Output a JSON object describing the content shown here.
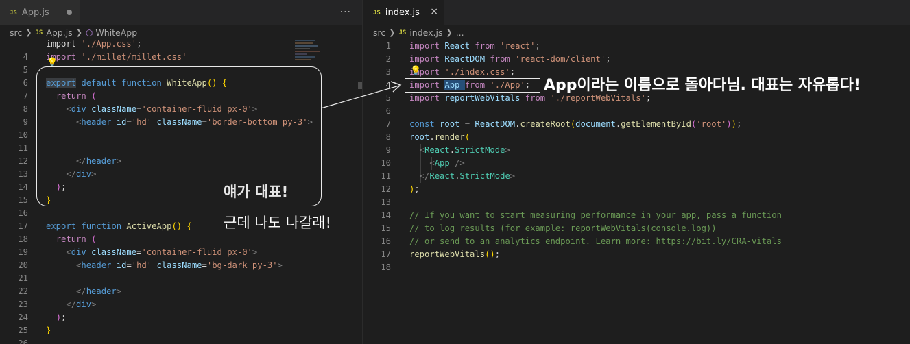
{
  "left_editor": {
    "tab": {
      "label": "App.js",
      "badge": "JS"
    },
    "breadcrumb": {
      "folder": "src",
      "file": "App.js",
      "badge": "JS",
      "symbol": "WhiteApp"
    },
    "more": "···",
    "lines": [
      {
        "n": "",
        "parts": [
          [
            "plain",
            "import "
          ],
          [
            "str",
            "'./App.css'"
          ],
          [
            "plain",
            ";"
          ]
        ]
      },
      {
        "n": "4",
        "parts": [
          [
            "kc",
            "import "
          ],
          [
            "str",
            "'./millet/millet.css'"
          ]
        ]
      },
      {
        "n": "5",
        "parts": []
      },
      {
        "n": "6",
        "parts": [
          [
            "kw",
            "export"
          ],
          [
            "plain",
            " "
          ],
          [
            "kw",
            "default "
          ],
          [
            "kw",
            "function "
          ],
          [
            "fn",
            "WhiteApp"
          ],
          [
            "br1",
            "()"
          ],
          [
            "plain",
            " "
          ],
          [
            "br1",
            "{"
          ]
        ]
      },
      {
        "n": "7",
        "parts": [
          [
            "plain",
            "  "
          ],
          [
            "kc",
            "return "
          ],
          [
            "br2",
            "("
          ]
        ]
      },
      {
        "n": "8",
        "parts": [
          [
            "plain",
            "    "
          ],
          [
            "pun",
            "<"
          ],
          [
            "tag",
            "div "
          ],
          [
            "attr",
            "className"
          ],
          [
            "plain",
            "="
          ],
          [
            "str",
            "'container-fluid px-0'"
          ],
          [
            "pun",
            ">"
          ]
        ]
      },
      {
        "n": "9",
        "parts": [
          [
            "plain",
            "      "
          ],
          [
            "pun",
            "<"
          ],
          [
            "tag",
            "header "
          ],
          [
            "attr",
            "id"
          ],
          [
            "plain",
            "="
          ],
          [
            "str",
            "'hd' "
          ],
          [
            "attr",
            "className"
          ],
          [
            "plain",
            "="
          ],
          [
            "str",
            "'border-bottom py-3'"
          ],
          [
            "pun",
            ">"
          ]
        ]
      },
      {
        "n": "10",
        "parts": []
      },
      {
        "n": "11",
        "parts": []
      },
      {
        "n": "12",
        "parts": [
          [
            "plain",
            "      "
          ],
          [
            "pun",
            "</"
          ],
          [
            "tag",
            "header"
          ],
          [
            "pun",
            ">"
          ]
        ]
      },
      {
        "n": "13",
        "parts": [
          [
            "plain",
            "    "
          ],
          [
            "pun",
            "</"
          ],
          [
            "tag",
            "div"
          ],
          [
            "pun",
            ">"
          ]
        ]
      },
      {
        "n": "14",
        "parts": [
          [
            "plain",
            "  "
          ],
          [
            "br2",
            ")"
          ],
          [
            "plain",
            ";"
          ]
        ]
      },
      {
        "n": "15",
        "parts": [
          [
            "br1",
            "}"
          ]
        ]
      },
      {
        "n": "16",
        "parts": []
      },
      {
        "n": "17",
        "parts": [
          [
            "kw",
            "export"
          ],
          [
            "plain",
            " "
          ],
          [
            "kw",
            "function "
          ],
          [
            "fn",
            "ActiveApp"
          ],
          [
            "br1",
            "()"
          ],
          [
            "plain",
            " "
          ],
          [
            "br1",
            "{"
          ]
        ]
      },
      {
        "n": "18",
        "parts": [
          [
            "plain",
            "  "
          ],
          [
            "kc",
            "return "
          ],
          [
            "br2",
            "("
          ]
        ]
      },
      {
        "n": "19",
        "parts": [
          [
            "plain",
            "    "
          ],
          [
            "pun",
            "<"
          ],
          [
            "tag",
            "div "
          ],
          [
            "attr",
            "className"
          ],
          [
            "plain",
            "="
          ],
          [
            "str",
            "'container-fluid px-0'"
          ],
          [
            "pun",
            ">"
          ]
        ]
      },
      {
        "n": "20",
        "parts": [
          [
            "plain",
            "      "
          ],
          [
            "pun",
            "<"
          ],
          [
            "tag",
            "header "
          ],
          [
            "attr",
            "id"
          ],
          [
            "plain",
            "="
          ],
          [
            "str",
            "'hd' "
          ],
          [
            "attr",
            "className"
          ],
          [
            "plain",
            "="
          ],
          [
            "str",
            "'bg-dark py-3'"
          ],
          [
            "pun",
            ">"
          ]
        ]
      },
      {
        "n": "21",
        "parts": []
      },
      {
        "n": "22",
        "parts": [
          [
            "plain",
            "      "
          ],
          [
            "pun",
            "</"
          ],
          [
            "tag",
            "header"
          ],
          [
            "pun",
            ">"
          ]
        ]
      },
      {
        "n": "23",
        "parts": [
          [
            "plain",
            "    "
          ],
          [
            "pun",
            "</"
          ],
          [
            "tag",
            "div"
          ],
          [
            "pun",
            ">"
          ]
        ]
      },
      {
        "n": "24",
        "parts": [
          [
            "plain",
            "  "
          ],
          [
            "br2",
            ")"
          ],
          [
            "plain",
            ";"
          ]
        ]
      },
      {
        "n": "25",
        "parts": [
          [
            "br1",
            "}"
          ]
        ]
      },
      {
        "n": "26",
        "parts": []
      }
    ]
  },
  "right_editor": {
    "tab": {
      "label": "index.js",
      "badge": "JS",
      "close": "×"
    },
    "breadcrumb": {
      "folder": "src",
      "file": "index.js",
      "badge": "JS",
      "symbol": "..."
    },
    "lines": [
      {
        "n": "1",
        "parts": [
          [
            "kc",
            "import "
          ],
          [
            "var",
            "React "
          ],
          [
            "kc",
            "from "
          ],
          [
            "str",
            "'react'"
          ],
          [
            "plain",
            ";"
          ]
        ]
      },
      {
        "n": "2",
        "parts": [
          [
            "kc",
            "import "
          ],
          [
            "var",
            "ReactDOM "
          ],
          [
            "kc",
            "from "
          ],
          [
            "str",
            "'react-dom/client'"
          ],
          [
            "plain",
            ";"
          ]
        ]
      },
      {
        "n": "3",
        "parts": [
          [
            "kc",
            "import "
          ],
          [
            "str",
            "'./index.css'"
          ],
          [
            "plain",
            ";"
          ]
        ]
      },
      {
        "n": "4",
        "parts": [
          [
            "kc",
            "import "
          ],
          [
            "var",
            "App "
          ],
          [
            "kc",
            "from "
          ],
          [
            "str",
            "'./App'"
          ],
          [
            "plain",
            ";"
          ]
        ]
      },
      {
        "n": "5",
        "parts": [
          [
            "kc",
            "import "
          ],
          [
            "var",
            "reportWebVitals "
          ],
          [
            "kc",
            "from "
          ],
          [
            "str",
            "'./reportWebVitals'"
          ],
          [
            "plain",
            ";"
          ]
        ]
      },
      {
        "n": "6",
        "parts": []
      },
      {
        "n": "7",
        "parts": [
          [
            "kw",
            "const "
          ],
          [
            "var",
            "root "
          ],
          [
            "plain",
            "= "
          ],
          [
            "var",
            "ReactDOM"
          ],
          [
            "plain",
            "."
          ],
          [
            "fn",
            "createRoot"
          ],
          [
            "br1",
            "("
          ],
          [
            "var",
            "document"
          ],
          [
            "plain",
            "."
          ],
          [
            "fn",
            "getElementById"
          ],
          [
            "br2",
            "("
          ],
          [
            "str",
            "'root'"
          ],
          [
            "br2",
            ")"
          ],
          [
            "br1",
            ")"
          ],
          [
            "plain",
            ";"
          ]
        ]
      },
      {
        "n": "8",
        "parts": [
          [
            "var",
            "root"
          ],
          [
            "plain",
            "."
          ],
          [
            "fn",
            "render"
          ],
          [
            "br1",
            "("
          ]
        ]
      },
      {
        "n": "9",
        "parts": [
          [
            "plain",
            "  "
          ],
          [
            "pun",
            "<"
          ],
          [
            "cls",
            "React"
          ],
          [
            "plain",
            "."
          ],
          [
            "cls",
            "StrictMode"
          ],
          [
            "pun",
            ">"
          ]
        ]
      },
      {
        "n": "10",
        "parts": [
          [
            "plain",
            "    "
          ],
          [
            "pun",
            "<"
          ],
          [
            "cls",
            "App "
          ],
          [
            "pun",
            "/>"
          ]
        ]
      },
      {
        "n": "11",
        "parts": [
          [
            "plain",
            "  "
          ],
          [
            "pun",
            "</"
          ],
          [
            "cls",
            "React"
          ],
          [
            "plain",
            "."
          ],
          [
            "cls",
            "StrictMode"
          ],
          [
            "pun",
            ">"
          ]
        ]
      },
      {
        "n": "12",
        "parts": [
          [
            "br1",
            ")"
          ],
          [
            "plain",
            ";"
          ]
        ]
      },
      {
        "n": "13",
        "parts": []
      },
      {
        "n": "14",
        "parts": [
          [
            "cmt",
            "// If you want to start measuring performance in your app, pass a function"
          ]
        ]
      },
      {
        "n": "15",
        "parts": [
          [
            "cmt",
            "// to log results (for example: reportWebVitals(console.log))"
          ]
        ]
      },
      {
        "n": "16",
        "parts": [
          [
            "cmt",
            "// or send to an analytics endpoint. Learn more: "
          ],
          [
            "link",
            "https://bit.ly/CRA-vitals"
          ]
        ]
      },
      {
        "n": "17",
        "parts": [
          [
            "fn",
            "reportWebVitals"
          ],
          [
            "br1",
            "()"
          ],
          [
            "plain",
            ";"
          ]
        ]
      },
      {
        "n": "18",
        "parts": []
      }
    ]
  },
  "annotations": {
    "representative": "얘가 대표!",
    "me_too": "근데 나도 나갈래!",
    "app_name": "App이라는 이름으로 돌아다님. 대표는 자유롭다!"
  },
  "colors": {
    "annotation_stroke": "#e8e8e8",
    "editor_bg": "#1e1e1e",
    "tab_bar": "#252526"
  }
}
